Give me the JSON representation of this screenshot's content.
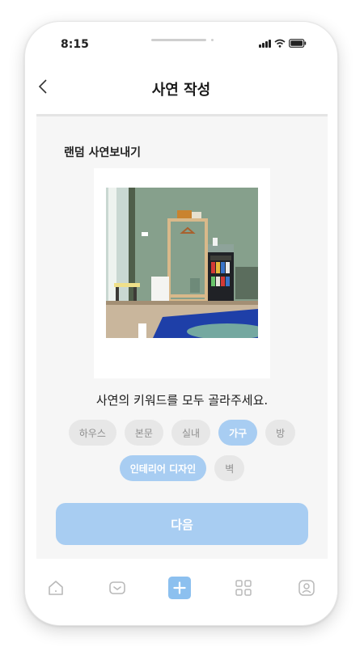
{
  "status_bar": {
    "time": "8:15"
  },
  "header": {
    "title": "사연 작성",
    "back_icon": "chevron-left-icon"
  },
  "section": {
    "title": "랜덤 사연보내기"
  },
  "photo": {
    "description_icon": "room-photo"
  },
  "prompt": "사연의 키워드를 모두 골라주세요.",
  "keywords": {
    "row1": [
      {
        "label": "하우스",
        "selected": false
      },
      {
        "label": "본문",
        "selected": false
      },
      {
        "label": "실내",
        "selected": false
      },
      {
        "label": "가구",
        "selected": true
      },
      {
        "label": "방",
        "selected": false
      }
    ],
    "row2": [
      {
        "label": "인테리어 디자인",
        "selected": true
      },
      {
        "label": "벽",
        "selected": false
      }
    ]
  },
  "next_button": {
    "label": "다음"
  },
  "tab_bar": {
    "icons": [
      "home-icon",
      "inbox-icon",
      "add-icon",
      "grid-icon",
      "profile-icon"
    ]
  },
  "colors": {
    "accent": "#a8cdf2",
    "active_tab": "#8cc0ef",
    "chip_bg": "#e7e7e7",
    "chip_text": "#8e8e8e"
  }
}
